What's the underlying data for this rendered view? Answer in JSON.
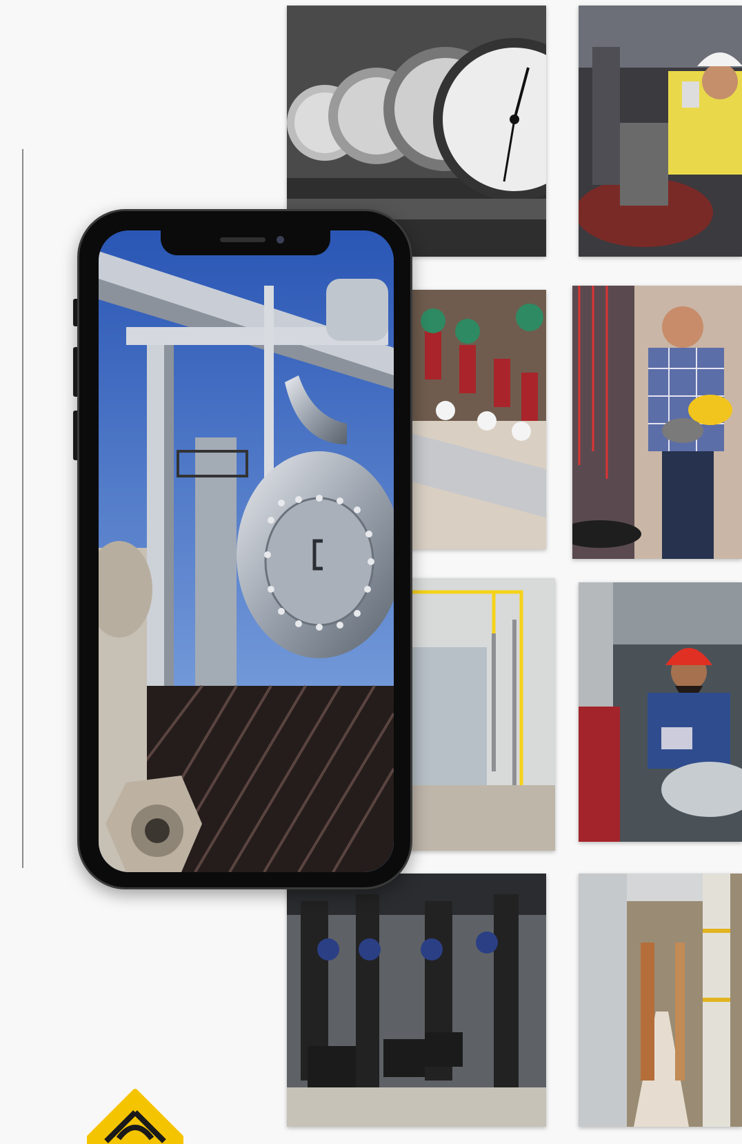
{
  "gallery": {
    "tiles": [
      {
        "id": "pressure-gauges",
        "tone": "grayscale"
      },
      {
        "id": "engineer-hardhat-tablet",
        "tone": "color"
      },
      {
        "id": "valves-manifold",
        "tone": "color"
      },
      {
        "id": "technician-warehouse",
        "tone": "color"
      },
      {
        "id": "industrial-boiler",
        "tone": "color"
      },
      {
        "id": "worker-red-helmet",
        "tone": "color"
      },
      {
        "id": "pump-room",
        "tone": "color"
      },
      {
        "id": "pipe-corridor",
        "tone": "color"
      }
    ]
  },
  "phone": {
    "screen_image": "refinery-pipes-vessel"
  },
  "colors": {
    "background": "#f8f8f8",
    "accent": "#f5c400",
    "sky": "#3f6fc4"
  },
  "icons": {
    "badge": "yellow-diamond-icon"
  }
}
